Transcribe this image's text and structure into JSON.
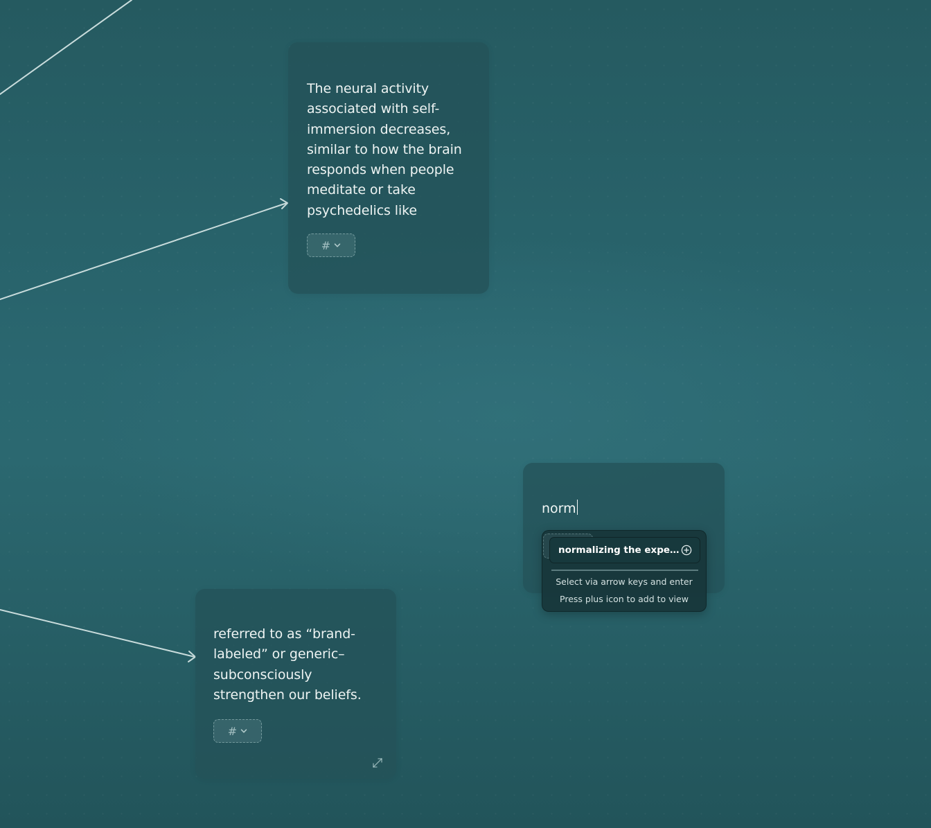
{
  "canvas": {
    "cards": [
      {
        "text": "The neural activity associated with self-immersion decreases, similar to how the brain responds when people meditate or take psychedelics like",
        "tag_symbol": "#"
      },
      {
        "text": "referred to as “brand-labeled” or generic–subconsciously strengthen our beliefs.",
        "tag_symbol": "#"
      }
    ],
    "draft_card": {
      "input_value": "norm"
    },
    "suggestions": {
      "items": [
        {
          "label": "normalizing the experi..."
        }
      ],
      "hint_select": "Select via arrow keys and enter",
      "hint_plus": "Press plus icon to add to view"
    }
  },
  "colors": {
    "background": "#2a6770",
    "card": "#245258",
    "connector": "#c9dcdc",
    "dropdown": "#18363a"
  },
  "icons": [
    "hashtag-icon",
    "chevron-down-icon",
    "expand-icon",
    "plus-circle-icon",
    "arrow-head-icon"
  ]
}
